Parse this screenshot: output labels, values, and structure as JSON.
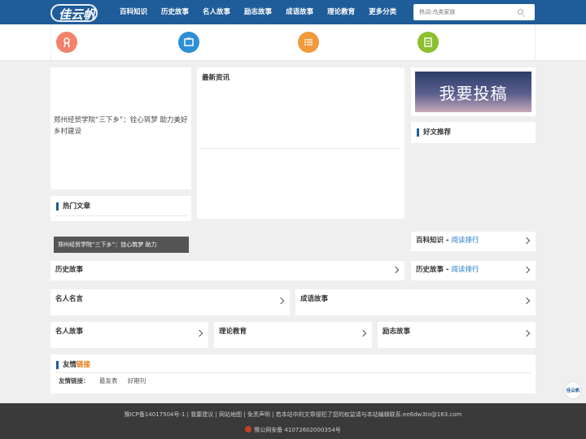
{
  "header": {
    "logo_text": "佳云帆",
    "nav": [
      "百科知识",
      "历史故事",
      "名人故事",
      "励志故事",
      "成语故事",
      "理论教育",
      "更多分类"
    ],
    "search": {
      "placeholder": "热词:鸟类家族",
      "icon": "search-icon"
    }
  },
  "colors": {
    "header": "#1f5c9a",
    "icon1": "#f0836b",
    "icon2": "#2e8fd6",
    "icon3": "#f29a3a",
    "icon4": "#8dbf2f",
    "accent_link": "#1f78c8",
    "accent_orange": "#e07a10"
  },
  "featured": {
    "image_alt": "郑州经贸学院“三下乡”：铨心筑梦 助力美好乡村建设",
    "caption": "郑州经贸学院“三下乡”：铨心筑梦 助力"
  },
  "hot_articles": {
    "title": "热门文章"
  },
  "news": {
    "title": "最新资讯"
  },
  "submit_banner": {
    "text": "我要投稿"
  },
  "recommended": {
    "title": "好文推荐"
  },
  "rank_bars": [
    {
      "title": "百科知识",
      "link": "阅读排行"
    },
    {
      "title": "历史故事",
      "link": "阅读排行"
    }
  ],
  "sections": {
    "history": "历史故事",
    "quotes": "名人名言",
    "idioms": "成语故事",
    "celebrity": "名人故事",
    "theory": "理论教育",
    "inspire": "励志故事"
  },
  "friends": {
    "title_a": "友情",
    "title_b": "链接",
    "label": "友情链接：",
    "links": [
      "最发表",
      "好期刊"
    ]
  },
  "footer": {
    "line1": "豫ICP备14017504号-1 | 我要建议 | 网站地图 | 免责声明 | 若本站中的文章侵犯了您的权益请与本站编辑联系:ee6dw3to@163.com",
    "line2": "豫公网安备 41072602000354号"
  },
  "float_button": "佳云帆"
}
